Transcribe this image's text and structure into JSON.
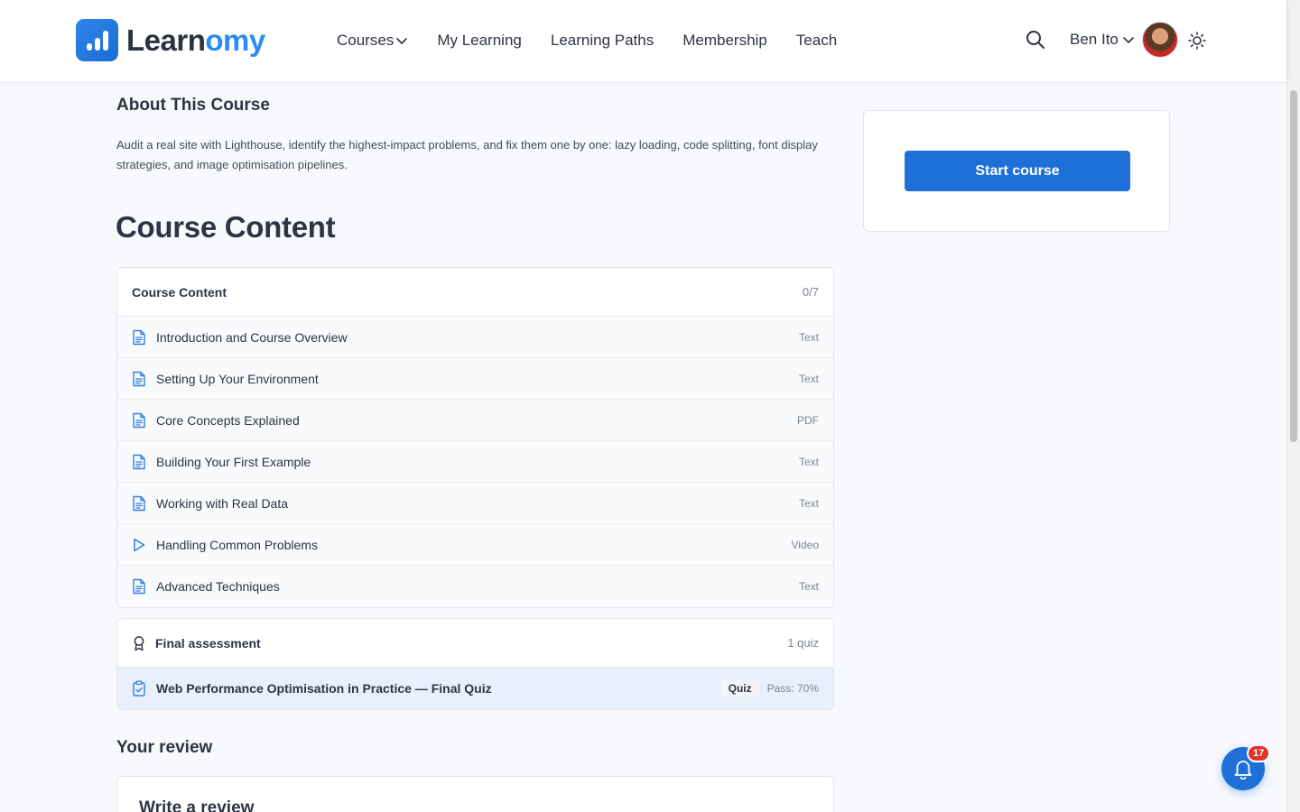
{
  "header": {
    "logo": {
      "part1": "Learn",
      "part2": "omy"
    },
    "nav": [
      {
        "label": "Courses",
        "has_dropdown": true
      },
      {
        "label": "My Learning"
      },
      {
        "label": "Learning Paths"
      },
      {
        "label": "Membership"
      },
      {
        "label": "Teach"
      }
    ],
    "user": {
      "name": "Ben Ito"
    },
    "icons": {
      "search": "search-icon",
      "theme": "sun-icon"
    }
  },
  "about": {
    "title": "About This Course",
    "text": "Audit a real site with Lighthouse, identify the highest-impact problems, and fix them one by one: lazy loading, code splitting, font display strategies, and image optimisation pipelines."
  },
  "content": {
    "heading": "Course Content",
    "section": {
      "title": "Course Content",
      "progress": "0/7",
      "lessons": [
        {
          "title": "Introduction and Course Overview",
          "type": "Text",
          "icon": "document-icon"
        },
        {
          "title": "Setting Up Your Environment",
          "type": "Text",
          "icon": "document-icon"
        },
        {
          "title": "Core Concepts Explained",
          "type": "PDF",
          "icon": "document-icon"
        },
        {
          "title": "Building Your First Example",
          "type": "Text",
          "icon": "document-icon"
        },
        {
          "title": "Working with Real Data",
          "type": "Text",
          "icon": "document-icon"
        },
        {
          "title": "Handling Common Problems",
          "type": "Video",
          "icon": "play-icon"
        },
        {
          "title": "Advanced Techniques",
          "type": "Text",
          "icon": "document-icon"
        }
      ]
    },
    "assessment": {
      "title": "Final assessment",
      "count": "1 quiz",
      "quiz": {
        "title": "Web Performance Optimisation in Practice — Final Quiz",
        "badge": "Quiz",
        "pass": "Pass: 70%"
      }
    }
  },
  "review": {
    "title": "Your review",
    "card_title": "Write a review"
  },
  "sidebar": {
    "start_label": "Start course"
  },
  "notifications": {
    "count": "17"
  },
  "colors": {
    "primary": "#1f6fd9",
    "brand_accent": "#2b8cf0",
    "badge": "#e0342b",
    "background": "#f7f9fc"
  }
}
